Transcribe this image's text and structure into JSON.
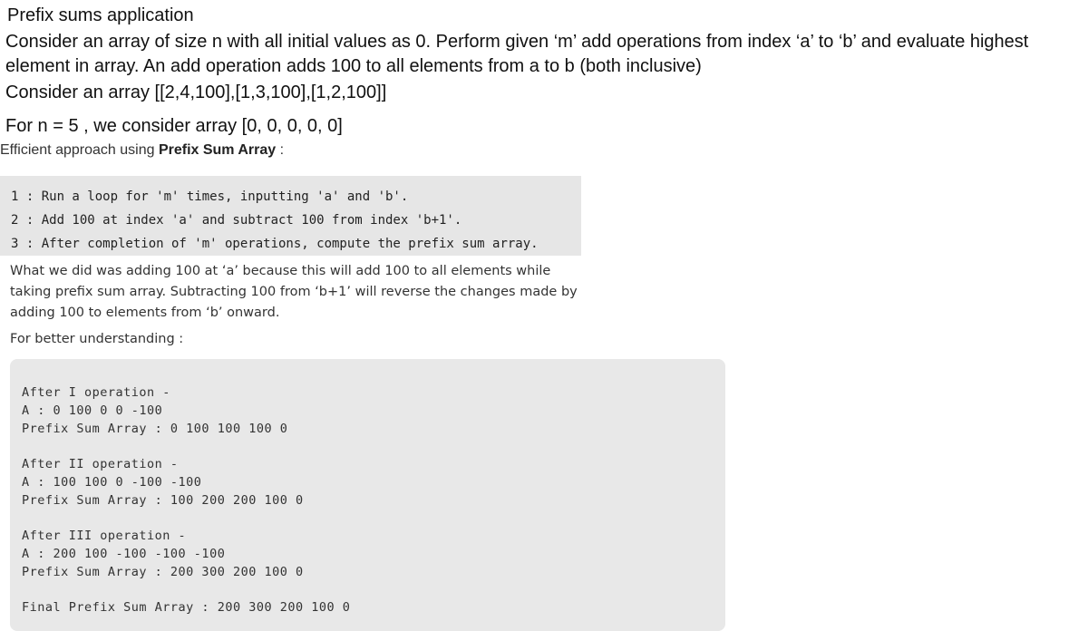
{
  "title": "Prefix sums application",
  "problem": {
    "line1": "Consider an array of size n with all initial values as 0. Perform given ‘m’ add operations from index ‘a’ to ‘b’ and evaluate highest",
    "line2": "element in array. An add operation adds 100 to all elements from a to b (both inclusive)",
    "line3": "Consider an array [[2,4,100],[1,3,100],[1,2,100]]",
    "line4": "For n = 5 , we consider array [0, 0, 0, 0, 0]"
  },
  "approach": {
    "prefix": "Efficient approach using ",
    "bold": "Prefix Sum Array",
    "suffix": " :"
  },
  "steps": [
    "1 : Run a loop for 'm' times, inputting 'a' and 'b'.",
    "2 : Add 100 at index 'a' and subtract 100 from index 'b+1'.",
    "3 : After completion of 'm' operations, compute the prefix sum array."
  ],
  "explanation": {
    "line1": "What we did was adding 100 at ‘a’ because this will add 100 to all elements while",
    "line2": "taking prefix sum array. Subtracting 100 from ‘b+1’ will reverse the changes made by",
    "line3": "adding 100 to elements from ‘b’ onward."
  },
  "better_understanding": "For better understanding :",
  "code": [
    "After I operation -",
    "A : 0 100 0 0 -100",
    "Prefix Sum Array : 0 100 100 100 0",
    "After II operation -",
    "A : 100 100 0 -100 -100",
    "Prefix Sum Array : 100 200 200 100 0",
    "After III operation -",
    "A : 200 100 -100 -100 -100",
    "Prefix Sum Array : 200 300 200 100 0",
    "Final Prefix Sum Array : 200 300 200 100 0"
  ]
}
